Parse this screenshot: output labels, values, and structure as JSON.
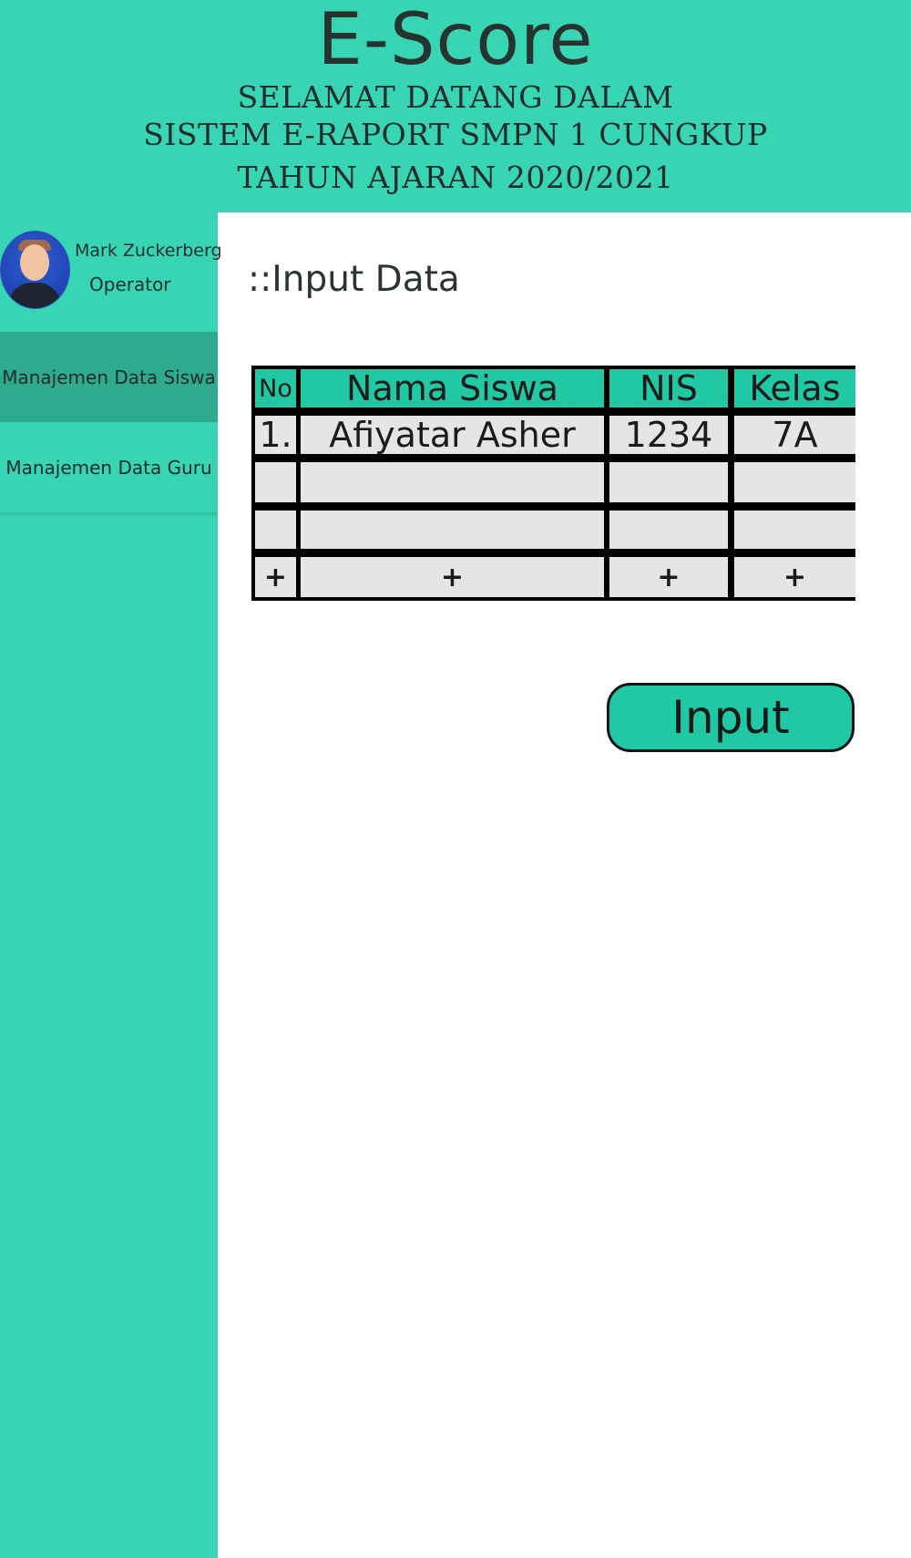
{
  "header": {
    "app_title": "E-Score",
    "line1": "SELAMAT DATANG DALAM",
    "line2": "SISTEM E-RAPORT SMPN 1 CUNGKUP",
    "line3": "TAHUN AJARAN  2020/2021",
    "background_color": "#38d5b4"
  },
  "sidebar": {
    "user": {
      "name": "Mark Zuckerberg",
      "role": "Operator"
    },
    "items": [
      {
        "label": "Manajemen Data Siswa",
        "active": true
      },
      {
        "label": "Manajemen Data Guru",
        "active": false
      }
    ],
    "active_color": "#2eaa8e"
  },
  "main": {
    "section_title": "::Input Data",
    "table": {
      "headers": [
        "No",
        "Nama Siswa",
        "NIS",
        "Kelas"
      ],
      "rows": [
        [
          "1.",
          "Afiyatar Asher",
          "1234",
          "7A"
        ],
        [
          "",
          "",
          "",
          ""
        ],
        [
          "",
          "",
          "",
          ""
        ]
      ],
      "add_row": [
        "+",
        "+",
        "+",
        "+"
      ]
    },
    "input_button": "Input",
    "accent_color": "#20c9a4"
  }
}
